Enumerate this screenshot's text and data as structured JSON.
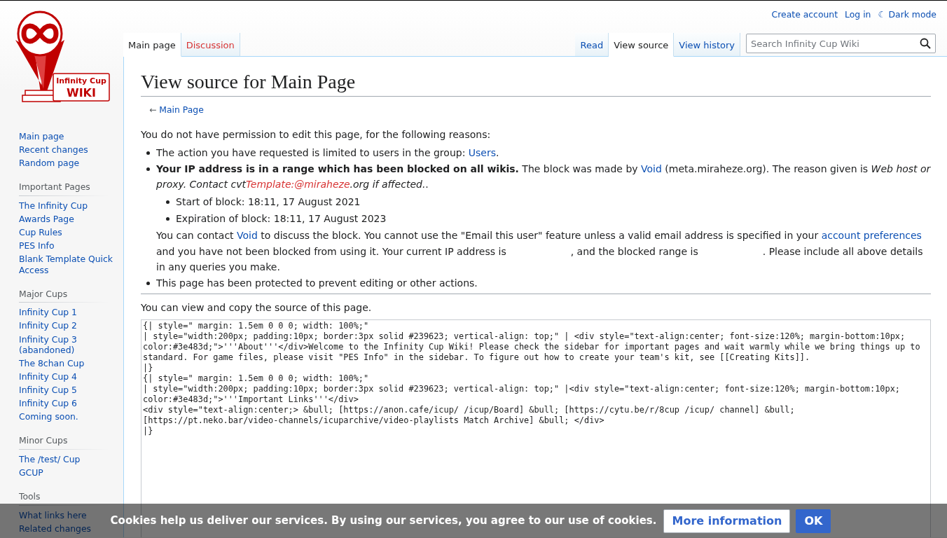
{
  "logo": {
    "line1": "Infinity Cup",
    "line2": "WIKI"
  },
  "personal_tools": [
    {
      "label": "Create account"
    },
    {
      "label": "Log in"
    },
    {
      "label": "Dark mode",
      "icon": "☾"
    }
  ],
  "namespace_tabs": [
    {
      "label": "Main page",
      "selected": true,
      "exists": true
    },
    {
      "label": "Discussion",
      "selected": false,
      "exists": false
    }
  ],
  "view_tabs": [
    {
      "label": "Read",
      "selected": false
    },
    {
      "label": "View source",
      "selected": true
    },
    {
      "label": "View history",
      "selected": false
    }
  ],
  "search": {
    "placeholder": "Search Infinity Cup Wiki"
  },
  "sidebar": {
    "navigation": [
      "Main page",
      "Recent changes",
      "Random page"
    ],
    "portals": [
      {
        "heading": "Important Pages",
        "items": [
          "The Infinity Cup",
          "Awards Page",
          "Cup Rules",
          "PES Info",
          "Blank Template Quick Access"
        ]
      },
      {
        "heading": "Major Cups",
        "items": [
          "Infinity Cup 1",
          "Infinity Cup 2",
          "Infinity Cup 3 (abandoned)",
          "The 8chan Cup",
          "Infinity Cup 4",
          "Infinity Cup 5",
          "Infinity Cup 6",
          "Coming soon."
        ]
      },
      {
        "heading": "Minor Cups",
        "items": [
          "The /test/ Cup",
          "GCUP"
        ]
      },
      {
        "heading": "Tools",
        "items": [
          "What links here",
          "Related changes"
        ]
      }
    ]
  },
  "page": {
    "title": "View source for Main Page",
    "back_link": {
      "arrow": "←",
      "label": "Main Page"
    },
    "intro": "You do not have permission to edit this page, for the following reasons:",
    "reasons": [
      {
        "segments": [
          {
            "kind": "text",
            "text": "The action you have requested is limited to users in the group: "
          },
          {
            "kind": "link",
            "text": "Users"
          },
          {
            "kind": "text",
            "text": "."
          }
        ]
      },
      {
        "segments": [
          {
            "kind": "bold",
            "text": "Your IP address is in a range which has been blocked on all wikis."
          },
          {
            "kind": "text",
            "text": " The block was made by "
          },
          {
            "kind": "link",
            "text": "Void"
          },
          {
            "kind": "text",
            "text": " (meta.miraheze.org). The reason given is "
          },
          {
            "kind": "italic",
            "text": "Web host or proxy. Contact cvt"
          },
          {
            "kind": "new-link",
            "text": "Template:@miraheze"
          },
          {
            "kind": "italic",
            "text": ".org if affected."
          },
          {
            "kind": "text",
            "text": "."
          }
        ],
        "sub_items": [
          "Start of block: 18:11, 17 August 2021",
          "Expiration of block: 18:11, 17 August 2023"
        ],
        "note": [
          {
            "kind": "text",
            "text": "You can contact "
          },
          {
            "kind": "link",
            "text": "Void"
          },
          {
            "kind": "text",
            "text": " to discuss the block. You cannot use the \"Email this user\" feature unless a valid email address is specified in your "
          },
          {
            "kind": "link",
            "text": "account preferences"
          },
          {
            "kind": "text",
            "text": " and you have not been blocked from using it. Your current IP address is",
            "redacted_after": true
          },
          {
            "kind": "text",
            "text": ", and the blocked range is",
            "redacted_after": true
          },
          {
            "kind": "text",
            "text": ". Please include all above details in any queries you make."
          }
        ]
      },
      {
        "segments": [
          {
            "kind": "text",
            "text": "This page has been protected to prevent editing or other actions."
          }
        ]
      }
    ],
    "view_note": "You can view and copy the source of this page.",
    "source_lines": [
      "{| style=\" margin: 1.5em 0 0 0; width: 100%;\"",
      "| style=\"width:200px; padding:10px; border:3px solid #239623; vertical-align: top;\" | <div style=\"text-align:center; font-size:120%; margin-bottom:10px; color:#3e483d;\">'''About'''</div>Welcome to the Infinity Cup Wiki! Please check the sidebar for important pages and wait warmly while we bring things up to standard. For game files, please visit \"PES Info\" in the sidebar. To figure out how to create your team's kit, see [[Creating Kits]].",
      "|}",
      "{| style=\" margin: 1.5em 0 0 0; width: 100%;\"",
      "| style=\"width:200px; padding:10px; border:3px solid #239623; vertical-align: top;\" |<div style=\"text-align:center; font-size:120%; margin-bottom:10px; color:#3e483d;\">'''Important Links'''</div>",
      "<div style=\"text-align:center;> &bull; [https://anon.cafe/icup/ /icup/Board] &bull; [https://cytu.be/r/8cup /icup/ channel] &bull; [https://pt.neko.bar/video-channels/icuparchive/video-playlists Match Archive] &bull; </div>",
      "|}"
    ]
  },
  "cookie_notice": {
    "message": "Cookies help us deliver our services. By using our services, you agree to our use of cookies.",
    "buttons": [
      {
        "label": "More information",
        "kind": "secondary"
      },
      {
        "label": "OK",
        "kind": "primary"
      }
    ]
  }
}
